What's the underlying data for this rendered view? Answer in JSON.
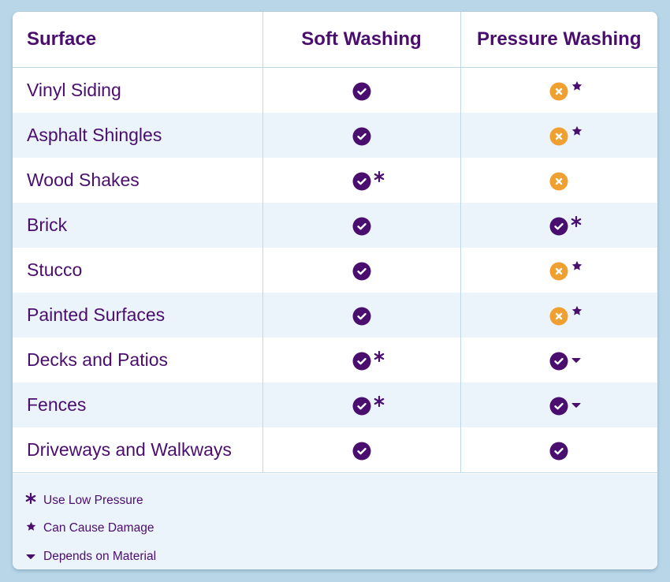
{
  "table": {
    "headers": [
      "Surface",
      "Soft Washing",
      "Pressure Washing"
    ],
    "rows": [
      {
        "surface": "Vinyl Siding",
        "soft": {
          "status": "yes",
          "note": ""
        },
        "pressure": {
          "status": "no",
          "note": "star"
        }
      },
      {
        "surface": "Asphalt Shingles",
        "soft": {
          "status": "yes",
          "note": ""
        },
        "pressure": {
          "status": "no",
          "note": "star"
        }
      },
      {
        "surface": "Wood Shakes",
        "soft": {
          "status": "yes",
          "note": "asterisk"
        },
        "pressure": {
          "status": "no",
          "note": ""
        }
      },
      {
        "surface": "Brick",
        "soft": {
          "status": "yes",
          "note": ""
        },
        "pressure": {
          "status": "yes",
          "note": "asterisk"
        }
      },
      {
        "surface": "Stucco",
        "soft": {
          "status": "yes",
          "note": ""
        },
        "pressure": {
          "status": "no",
          "note": "star"
        }
      },
      {
        "surface": "Painted Surfaces",
        "soft": {
          "status": "yes",
          "note": ""
        },
        "pressure": {
          "status": "no",
          "note": "star"
        }
      },
      {
        "surface": "Decks and Patios",
        "soft": {
          "status": "yes",
          "note": "asterisk"
        },
        "pressure": {
          "status": "yes",
          "note": "triangle"
        }
      },
      {
        "surface": "Fences",
        "soft": {
          "status": "yes",
          "note": "asterisk"
        },
        "pressure": {
          "status": "yes",
          "note": "triangle"
        }
      },
      {
        "surface": "Driveways and Walkways",
        "soft": {
          "status": "yes",
          "note": ""
        },
        "pressure": {
          "status": "yes",
          "note": ""
        }
      }
    ]
  },
  "legend": [
    {
      "symbol": "asterisk",
      "label": "Use Low Pressure"
    },
    {
      "symbol": "star",
      "label": "Can Cause Damage"
    },
    {
      "symbol": "triangle",
      "label": "Depends on Material"
    }
  ],
  "icons": {
    "yes": "check-circle-icon",
    "no": "x-circle-icon"
  },
  "colors": {
    "background": "#b8d6e8",
    "text": "#4a0e6e",
    "check": "#4a0e6e",
    "cross": "#f0a030",
    "alt_row": "#ebf3fb",
    "divider": "#bcd8ea"
  }
}
